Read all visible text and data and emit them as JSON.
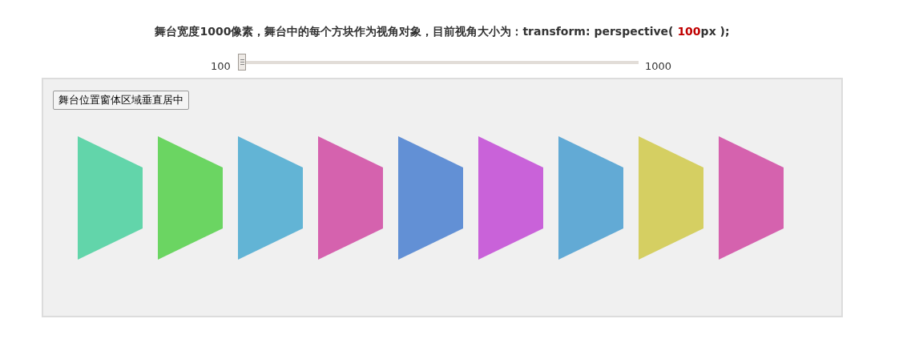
{
  "heading": {
    "prefix": "舞台宽度1000像素，舞台中的每个方块作为视角对象，目前视角大小为：transform: perspective(",
    "value": "100",
    "suffix": "px );"
  },
  "slider": {
    "min_label": "100",
    "max_label": "1000",
    "level": 0
  },
  "stage": {
    "button": "舞台位置窗体区域垂直居中",
    "blocks": [
      {
        "color": "#62d5aa"
      },
      {
        "color": "#6bd562"
      },
      {
        "color": "#62b4d5"
      },
      {
        "color": "#d562ae"
      },
      {
        "color": "#6290d5"
      },
      {
        "color": "#c962d9"
      },
      {
        "color": "#62aad5"
      },
      {
        "color": "#d5cf62"
      },
      {
        "color": "#d562ae"
      }
    ]
  }
}
